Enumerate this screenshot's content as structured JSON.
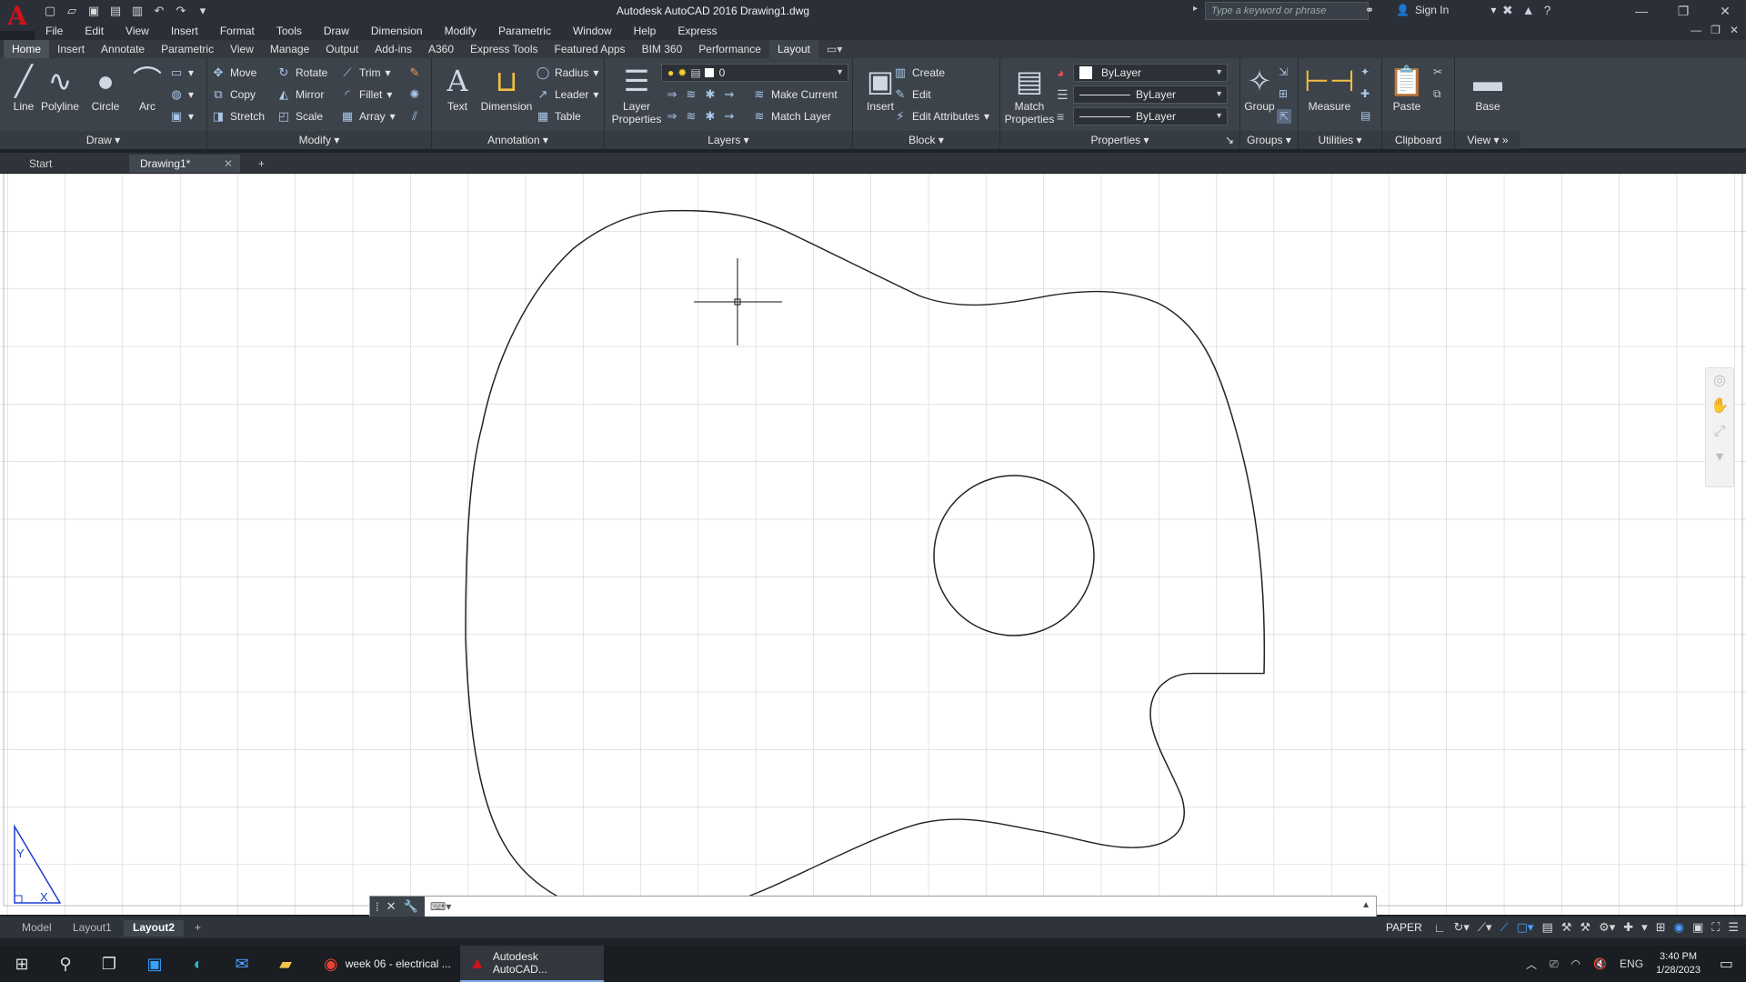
{
  "titlebar": {
    "app_logo": "A",
    "title": "Autodesk AutoCAD 2016   Drawing1.dwg",
    "search_placeholder": "Type a keyword or phrase",
    "sign_in": "Sign In"
  },
  "menu": [
    "File",
    "Edit",
    "View",
    "Insert",
    "Format",
    "Tools",
    "Draw",
    "Dimension",
    "Modify",
    "Parametric",
    "Window",
    "Help",
    "Express"
  ],
  "ribbon_tabs": [
    "Home",
    "Insert",
    "Annotate",
    "Parametric",
    "View",
    "Manage",
    "Output",
    "Add-ins",
    "A360",
    "Express Tools",
    "Featured Apps",
    "BIM 360",
    "Performance",
    "Layout"
  ],
  "ribbon": {
    "draw": {
      "title": "Draw",
      "line": "Line",
      "polyline": "Polyline",
      "circle": "Circle",
      "arc": "Arc"
    },
    "modify": {
      "title": "Modify",
      "move": "Move",
      "rotate": "Rotate",
      "trim": "Trim",
      "copy": "Copy",
      "mirror": "Mirror",
      "fillet": "Fillet",
      "stretch": "Stretch",
      "scale": "Scale",
      "array": "Array"
    },
    "annotation": {
      "title": "Annotation",
      "text": "Text",
      "dimension": "Dimension",
      "radius": "Radius",
      "leader": "Leader",
      "table": "Table"
    },
    "layers": {
      "title": "Layers",
      "layer_properties": "Layer Properties",
      "current_layer": "0",
      "make_current": "Make Current",
      "match_layer": "Match Layer"
    },
    "block": {
      "title": "Block",
      "insert": "Insert",
      "create": "Create",
      "edit": "Edit",
      "edit_attributes": "Edit Attributes"
    },
    "properties": {
      "title": "Properties",
      "match_properties": "Match Properties",
      "color": "ByLayer",
      "linetype": "ByLayer",
      "lineweight": "ByLayer"
    },
    "groups": {
      "title": "Groups",
      "group": "Group"
    },
    "utilities": {
      "title": "Utilities",
      "measure": "Measure"
    },
    "clipboard": {
      "title": "Clipboard",
      "paste": "Paste"
    },
    "view": {
      "title": "View",
      "base": "Base"
    }
  },
  "file_tabs": {
    "start": "Start",
    "drawing": "Drawing1*"
  },
  "layout_tabs": [
    "Model",
    "Layout1",
    "Layout2"
  ],
  "status": {
    "paper": "PAPER"
  },
  "taskbar": {
    "chrome_task": "week 06 - electrical ...",
    "autocad_task": "Autodesk AutoCAD...",
    "lang": "ENG",
    "time": "3:40 PM",
    "date": "1/28/2023"
  },
  "ucs": {
    "y_label": "Y",
    "x_label": "X"
  }
}
